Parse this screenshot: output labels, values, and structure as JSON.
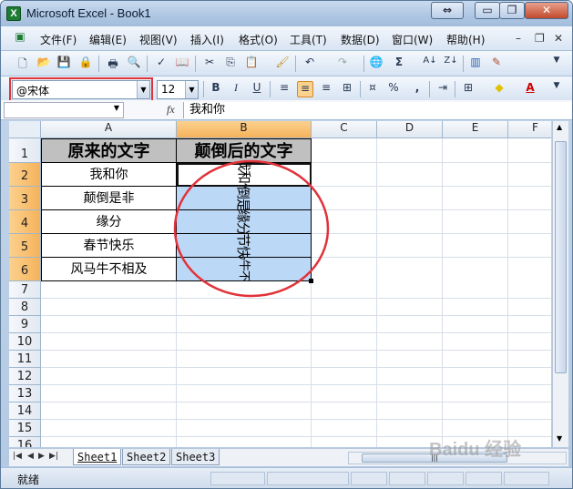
{
  "window": {
    "title": "Microsoft Excel - Book1",
    "app_icon": "X",
    "minimize_glyph": "▭",
    "restore_glyph": "❐",
    "close_glyph": "✕"
  },
  "menu": {
    "items": [
      "文件(F)",
      "编辑(E)",
      "视图(V)",
      "插入(I)",
      "格式(O)",
      "工具(T)",
      "数据(D)",
      "窗口(W)",
      "帮助(H)"
    ],
    "doc_min": "–",
    "doc_restore": "❐",
    "doc_close": "✕"
  },
  "toolbar_standard": {
    "sum_symbol": "Σ"
  },
  "toolbar_format": {
    "font_name": "@宋体",
    "font_size": "12",
    "bold": "B",
    "italic": "I",
    "underline": "U",
    "percent": "%",
    "comma": ","
  },
  "formula_bar": {
    "name_box": "",
    "fx_label": "fx",
    "content": "我和你"
  },
  "sheet": {
    "columns": [
      "A",
      "B",
      "C",
      "D",
      "E",
      "F"
    ],
    "rows": [
      "1",
      "2",
      "3",
      "4",
      "5",
      "6",
      "7",
      "8",
      "9",
      "10",
      "11",
      "12",
      "13",
      "14",
      "15",
      "16"
    ],
    "header_a": "原来的文字",
    "header_b": "颠倒后的文字",
    "col_a": [
      "我和你",
      "颠倒是非",
      "缘分",
      "春节快乐",
      "风马牛不相及"
    ],
    "col_b": [
      "我和你",
      "颠倒是非",
      "缘分",
      "春节快乐",
      "风马牛不相及"
    ]
  },
  "tabs": [
    "Sheet1",
    "Sheet2",
    "Sheet3"
  ],
  "status": {
    "ready": "就绪"
  },
  "watermark": "Baidu 经验",
  "colors": {
    "selection_fill": "#bcd8f7",
    "header_fill": "#c0c0c0",
    "annotation_red": "#e2323a",
    "selected_header": "#f6b25b"
  }
}
